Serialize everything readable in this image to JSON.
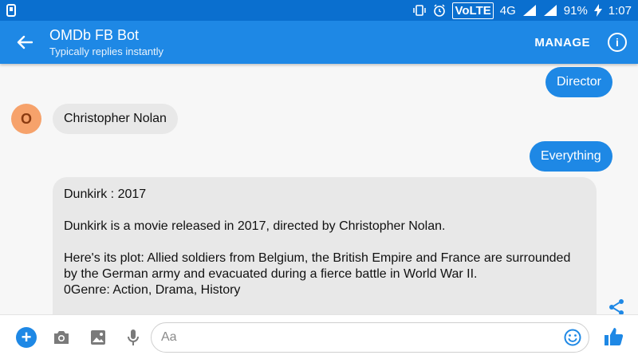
{
  "status_bar": {
    "network_4g": "4G",
    "volte": "VoLTE",
    "battery": "91%",
    "time": "1:07"
  },
  "header": {
    "title": "OMDb FB Bot",
    "subtitle": "Typically replies instantly",
    "manage_label": "MANAGE",
    "info_icon": "i"
  },
  "conversation": {
    "avatar_letter": "O",
    "messages": [
      {
        "from": "user",
        "text": "Director"
      },
      {
        "from": "bot",
        "text": "Christopher Nolan"
      },
      {
        "from": "user",
        "text": "Everything"
      }
    ],
    "card": {
      "title_line": "Dunkirk : 2017",
      "line_1": "Dunkirk is a movie released in 2017, directed by Christopher Nolan.",
      "line_2": "Here's its plot: Allied soldiers from Belgium, the British Empire and France are surrounded by the German army and evacuated during a fierce battle in World War II.",
      "line_3": "0Genre: Action, Drama, History"
    }
  },
  "composer": {
    "plus_label": "+",
    "placeholder": "Aa"
  },
  "colors": {
    "accent": "#1e88e5",
    "status_bar": "#0a6fcf",
    "avatar": "#f6a26b",
    "bot_bubble": "#e8e8e8"
  }
}
